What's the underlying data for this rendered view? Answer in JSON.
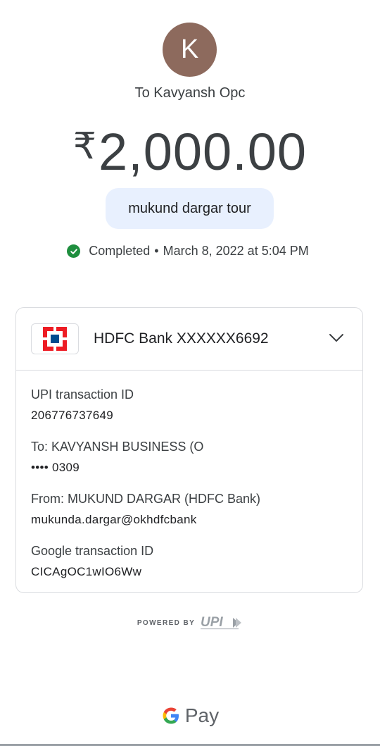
{
  "avatar": {
    "initial": "K",
    "color": "#8d6a5d"
  },
  "recipient": {
    "label": "To Kavyansh Opc"
  },
  "amount": {
    "currency_symbol": "₹",
    "value": "2,000.00"
  },
  "note": {
    "text": "mukund dargar tour"
  },
  "status": {
    "icon": "check-circle-icon",
    "text": "Completed",
    "separator": "•",
    "datetime": "March 8, 2022 at 5:04 PM",
    "color": "#1e8e3e"
  },
  "account": {
    "bank_name": "HDFC Bank XXXXXX6692",
    "icon": "hdfc-bank-logo",
    "expand_icon": "chevron-down-icon"
  },
  "details": {
    "upi_label": "UPI transaction ID",
    "upi_value": "206776737649",
    "to_label": "To: KAVYANSH BUSINESS (O",
    "to_value": "•••• 0309",
    "from_label": "From: MUKUND DARGAR (HDFC Bank)",
    "from_value": "mukunda.dargar@okhdfcbank",
    "google_label": "Google transaction ID",
    "google_value": "CICAgOC1wIO6Ww"
  },
  "footer": {
    "powered_by": "POWERED BY",
    "upi_logo": "UPI",
    "gpay_text": "Pay"
  }
}
